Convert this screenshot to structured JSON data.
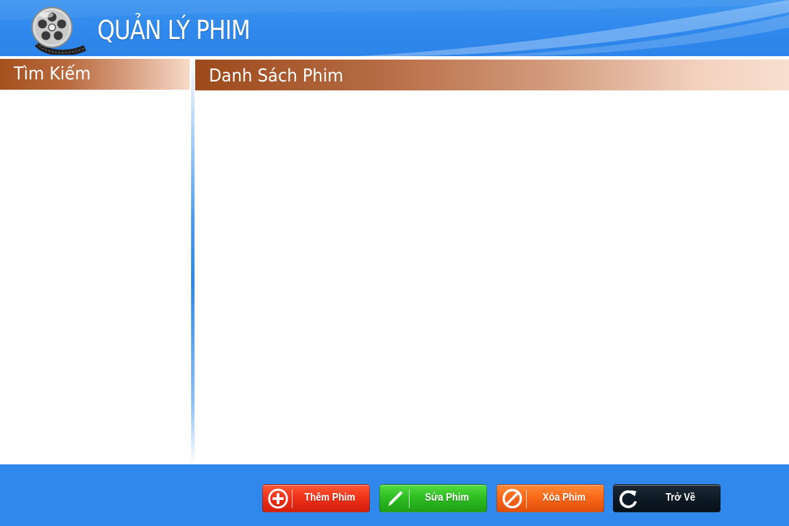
{
  "header": {
    "title": "QUẢN LÝ PHIM",
    "logo_icon": "film-reel-icon"
  },
  "search_panel": {
    "title": "Tìm Kiếm"
  },
  "list_panel": {
    "title": "Danh Sách Phim"
  },
  "footer": {
    "buttons": [
      {
        "label": "Thêm Phim",
        "icon": "plus-circle-icon",
        "color": "#e8321a"
      },
      {
        "label": "Sửa Phim",
        "icon": "pencil-icon",
        "color": "#2fbf22"
      },
      {
        "label": "Xóa Phim",
        "icon": "no-entry-icon",
        "color": "#fa6a1a"
      },
      {
        "label": "Trở Về",
        "icon": "refresh-icon",
        "color": "#0e1a25"
      }
    ]
  },
  "colors": {
    "header_blue": "#2f88ec",
    "footer_blue": "#3088ec",
    "panel_header_brown": "#a5511e",
    "panel_header_peach": "#f7dac8"
  }
}
